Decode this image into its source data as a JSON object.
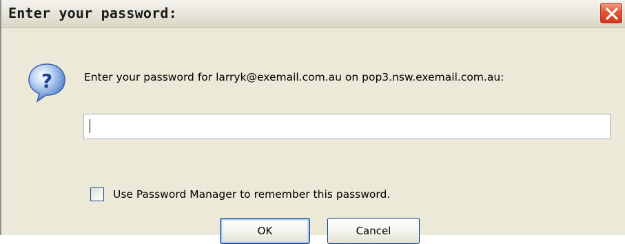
{
  "dialog": {
    "title": "Enter your password:",
    "message": "Enter your password for larryk@exemail.com.au on pop3.nsw.exemail.com.au:",
    "password_value": "",
    "remember_checked": false,
    "remember_label": "Use Password Manager to remember this password.",
    "ok_label": "OK",
    "cancel_label": "Cancel",
    "icons": {
      "dialog_icon": "question-icon",
      "close_icon": "close-icon"
    },
    "colors": {
      "close_button": "#e0583a",
      "default_button_focus": "#a8c4ef"
    }
  }
}
